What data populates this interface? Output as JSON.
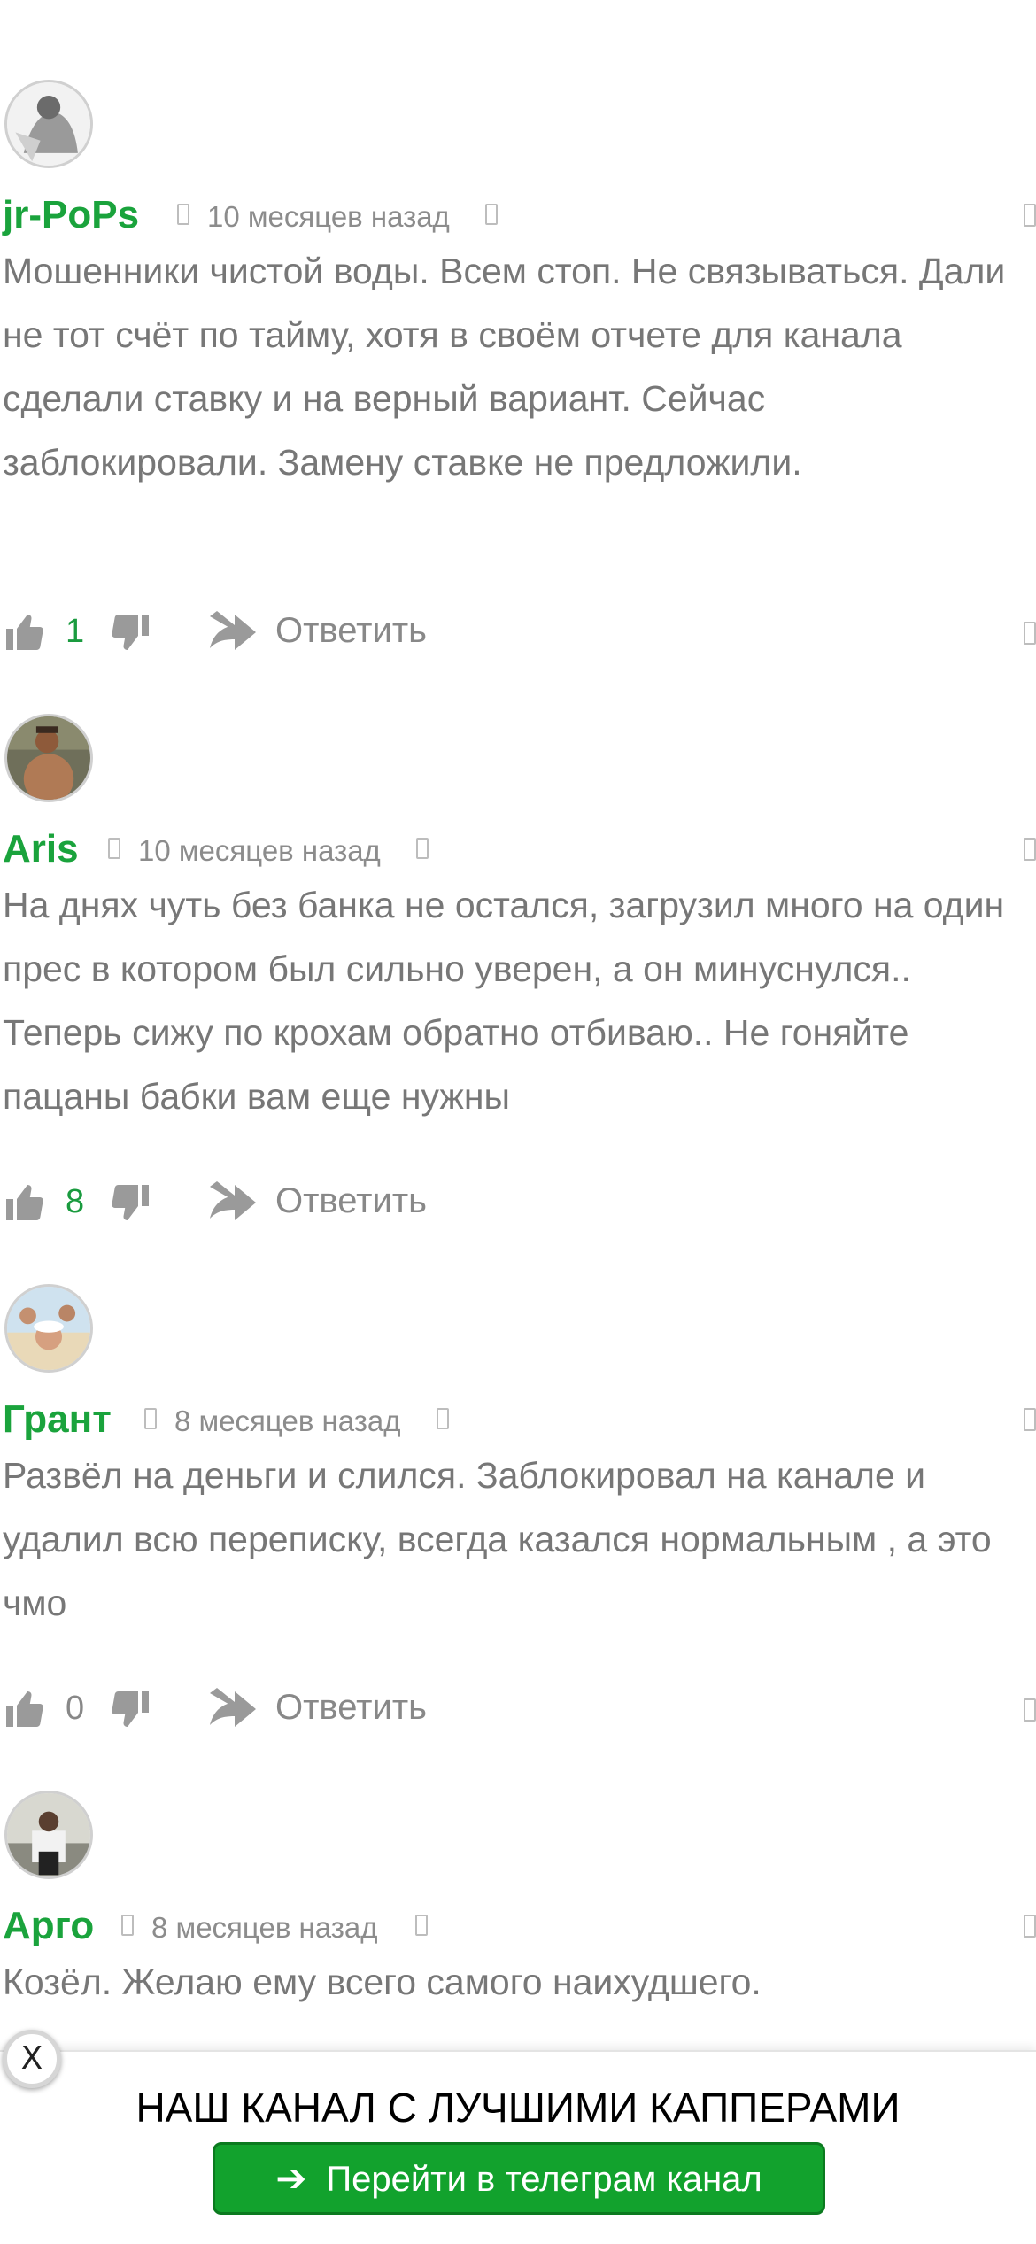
{
  "colors": {
    "author": "#1aa33c",
    "vote_count": "#1a9b3f",
    "banner_button": "#12a22d",
    "text": "#777777"
  },
  "icons": {
    "like": "thumbs-up-icon",
    "dislike": "thumbs-down-icon",
    "reply": "reply-arrow-icon",
    "banner_arrow": "arrow-right-icon"
  },
  "comments": [
    {
      "author": "jr-PoPs",
      "date": "10 месяцев назад",
      "text": "Мошенники чистой воды. Всем стоп. Не связываться. Дали не тот счёт по тайму, хотя в своём отчете для канала сделали ставку и на верный вариант. Сейчас заблокировали. Замену ставке не предложили.",
      "votes": "1",
      "reply_label": "Ответить"
    },
    {
      "author": "Aris",
      "date": "10 месяцев назад",
      "text": "На днях чуть без банка не остался, загрузил много на один прес в котором был сильно уверен, а он минуснулся.. Теперь сижу по крохам обратно отбиваю.. Не гоняйте пацаны бабки вам еще нужны",
      "votes": "8",
      "reply_label": "Ответить"
    },
    {
      "author": "Грант",
      "date": "8 месяцев назад",
      "text": "Развёл на деньги и слился. Заблокировал на канале и удалил всю переписку, всегда казался нормальным , а это чмо",
      "votes": "0",
      "reply_label": "Ответить"
    },
    {
      "author": "Арго",
      "date": "8 месяцев назад",
      "text": "Козёл. Желаю ему всего самого наихудшего."
    }
  ],
  "banner": {
    "close_label": "X",
    "title": "НАШ КАНАЛ С ЛУЧШИМИ КАППЕРАМИ",
    "button_label": "Перейти в телеграм канал",
    "button_arrow": "➔"
  }
}
